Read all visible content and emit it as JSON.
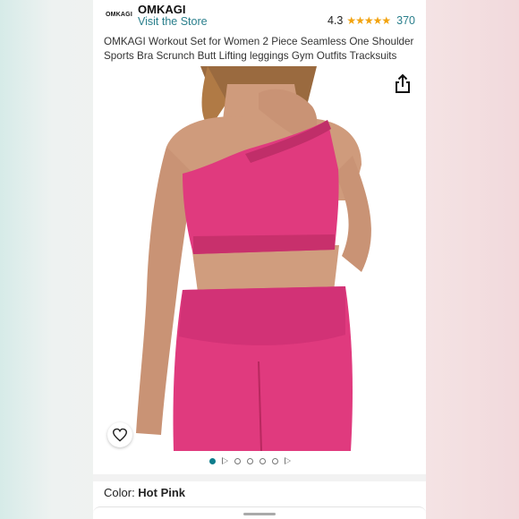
{
  "store": {
    "logo_text": "OMKAGI",
    "brand_name": "OMKAGI",
    "visit_link": "Visit the Store",
    "rating": "4.3",
    "stars": "★★★★★",
    "review_count": "370"
  },
  "product": {
    "title": "OMKAGI Workout Set for Women 2 Piece Seamless One Shoulder Sports Bra Scrunch Butt Lifting leggings Gym Outfits Tracksuits",
    "color_label": "Color:",
    "color_value": "Hot Pink",
    "colors": {
      "garment": "#e03a7e",
      "skin": "#cf9b7c",
      "accent_link": "#2a7f8c",
      "star": "#f2a30f",
      "dot_active": "#0f7d8c"
    }
  },
  "carousel": {
    "active_index": 0,
    "indicators": [
      "dot",
      "play",
      "dot",
      "dot",
      "dot",
      "dot",
      "play"
    ]
  },
  "icons": {
    "share": "share-icon",
    "heart": "heart-icon"
  }
}
